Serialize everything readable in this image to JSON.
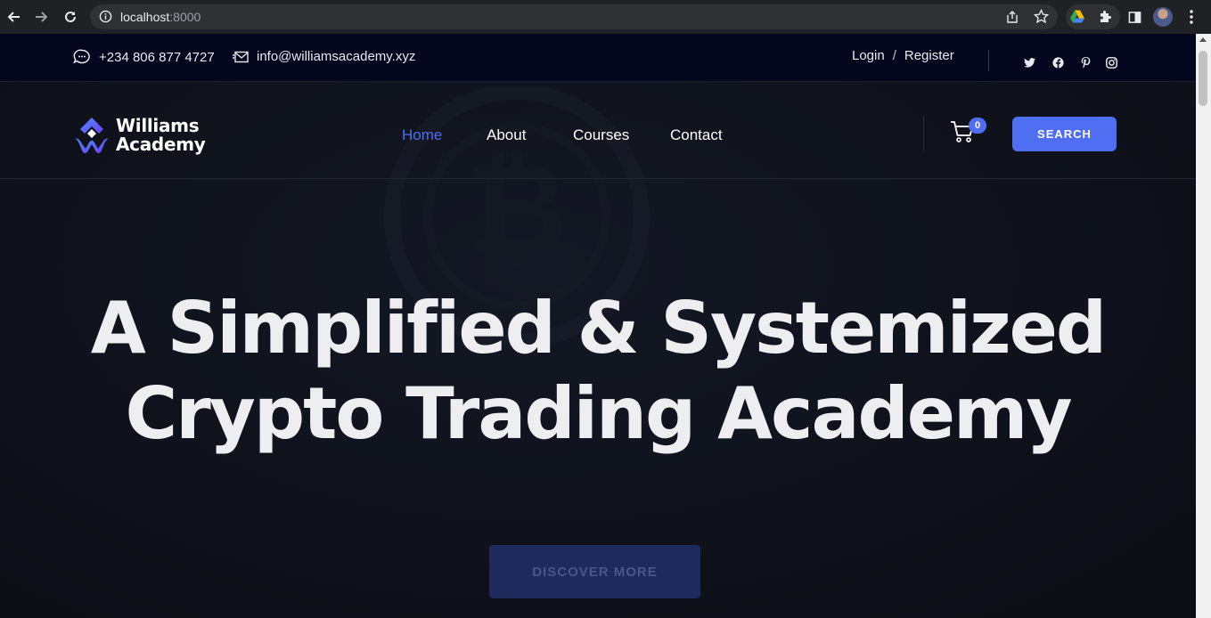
{
  "browser": {
    "url_host": "localhost",
    "url_port": ":8000",
    "icons": [
      "back-icon",
      "forward-icon",
      "reload-icon",
      "info-icon",
      "share-icon",
      "star-icon",
      "drive-icon",
      "puzzle-icon",
      "sidepanel-icon",
      "avatar",
      "menu-icon"
    ]
  },
  "topbar": {
    "phone": "+234 806 877 4727",
    "email": "info@williamsacademy.xyz",
    "login": "Login",
    "separator": "/",
    "register": "Register",
    "social": [
      "twitter-icon",
      "facebook-icon",
      "pinterest-icon",
      "instagram-icon"
    ]
  },
  "nav": {
    "logo_line1": "Williams",
    "logo_line2": "Academy",
    "items": [
      {
        "label": "Home",
        "active": true
      },
      {
        "label": "About",
        "active": false
      },
      {
        "label": "Courses",
        "active": false
      },
      {
        "label": "Contact",
        "active": false
      }
    ],
    "cart_count": "0",
    "search_label": "SEARCH"
  },
  "hero": {
    "title_line1": "A Simplified & Systemized",
    "title_line2": "Crypto Trading Academy",
    "cta_label": "DISCOVER MORE"
  },
  "colors": {
    "accent": "#4f6ef2",
    "topbar_bg": "#03061c",
    "page_bg": "#0f1117"
  }
}
